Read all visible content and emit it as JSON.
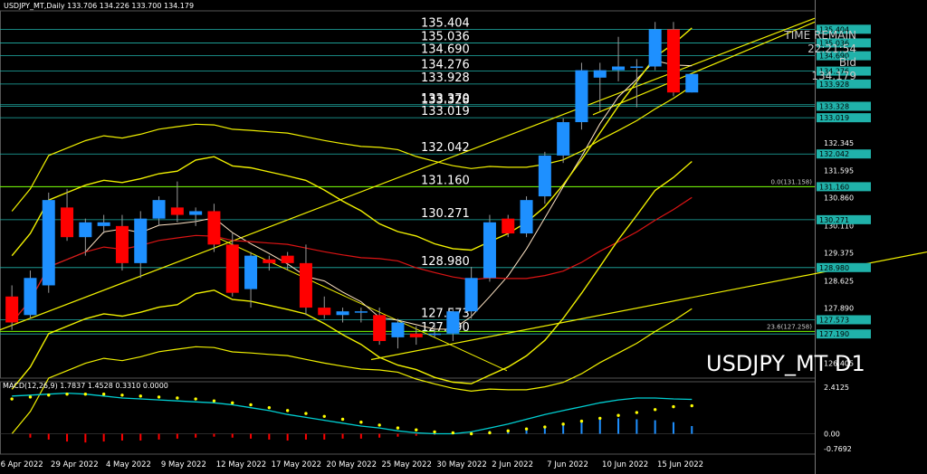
{
  "header": {
    "symbol_line": "USDJPY_MT,Daily 133.706 134.226 133.700 134.179"
  },
  "info_panel": {
    "time_remain_label": "TIME REMAIN",
    "time_remain_value": "22:21:54",
    "bid_label": "Bid",
    "bid_value": "134.179"
  },
  "watermark": "USDJPY_MT D1",
  "macd_label": "MACD(12,26,9) 1.7837 1.4528 0.3310 0.0000",
  "colors": {
    "background": "#000000",
    "bull": "#1e90ff",
    "bear": "#ff0000",
    "level_line": "#20b2aa",
    "envelope": "#f0f000",
    "ma_fast": "#ffe4c4",
    "ma_red": "#dc1414",
    "macd_main": "#00ced1",
    "macd_signal": "#ffff00"
  },
  "chart_data": {
    "type": "candlestick",
    "title": "USDJPY_MT D1",
    "ylim": [
      126.0,
      135.9
    ],
    "y_ticks": [
      "133.908",
      "132.345",
      "131.595",
      "130.860",
      "130.110",
      "129.375",
      "128.625",
      "127.890",
      "127.155",
      "126.405"
    ],
    "x_ticks": [
      {
        "label": "26 Apr 2022",
        "index": 0
      },
      {
        "label": "29 Apr 2022",
        "index": 3
      },
      {
        "label": "4 May 2022",
        "index": 6
      },
      {
        "label": "9 May 2022",
        "index": 9
      },
      {
        "label": "12 May 2022",
        "index": 12
      },
      {
        "label": "17 May 2022",
        "index": 15
      },
      {
        "label": "20 May 2022",
        "index": 18
      },
      {
        "label": "25 May 2022",
        "index": 21
      },
      {
        "label": "30 May 2022",
        "index": 24
      },
      {
        "label": "2 Jun 2022",
        "index": 27
      },
      {
        "label": "7 Jun 2022",
        "index": 30
      },
      {
        "label": "10 Jun 2022",
        "index": 33
      },
      {
        "label": "15 Jun 2022",
        "index": 36
      }
    ],
    "candles": [
      {
        "o": 128.2,
        "h": 128.5,
        "l": 127.3,
        "c": 127.5
      },
      {
        "o": 127.7,
        "h": 128.9,
        "l": 127.6,
        "c": 128.7
      },
      {
        "o": 128.5,
        "h": 131.0,
        "l": 128.3,
        "c": 130.8
      },
      {
        "o": 130.6,
        "h": 131.1,
        "l": 129.7,
        "c": 129.8
      },
      {
        "o": 129.8,
        "h": 130.3,
        "l": 129.3,
        "c": 130.2
      },
      {
        "o": 130.1,
        "h": 130.4,
        "l": 129.9,
        "c": 130.2
      },
      {
        "o": 130.1,
        "h": 130.4,
        "l": 128.9,
        "c": 129.1
      },
      {
        "o": 129.1,
        "h": 130.5,
        "l": 128.7,
        "c": 130.3
      },
      {
        "o": 130.3,
        "h": 130.9,
        "l": 130.1,
        "c": 130.8
      },
      {
        "o": 130.6,
        "h": 131.3,
        "l": 130.2,
        "c": 130.4
      },
      {
        "o": 130.4,
        "h": 130.6,
        "l": 130.1,
        "c": 130.5
      },
      {
        "o": 130.5,
        "h": 130.7,
        "l": 129.4,
        "c": 129.6
      },
      {
        "o": 129.6,
        "h": 129.9,
        "l": 128.2,
        "c": 128.3
      },
      {
        "o": 128.4,
        "h": 129.4,
        "l": 127.9,
        "c": 129.3
      },
      {
        "o": 129.2,
        "h": 129.3,
        "l": 128.9,
        "c": 129.1
      },
      {
        "o": 129.3,
        "h": 129.4,
        "l": 128.9,
        "c": 129.1
      },
      {
        "o": 129.1,
        "h": 129.6,
        "l": 127.7,
        "c": 127.9
      },
      {
        "o": 127.9,
        "h": 128.2,
        "l": 127.6,
        "c": 127.7
      },
      {
        "o": 127.7,
        "h": 127.9,
        "l": 127.5,
        "c": 127.8
      },
      {
        "o": 127.8,
        "h": 127.9,
        "l": 127.5,
        "c": 127.8
      },
      {
        "o": 127.7,
        "h": 127.9,
        "l": 126.9,
        "c": 127.0
      },
      {
        "o": 127.1,
        "h": 127.6,
        "l": 126.8,
        "c": 127.5
      },
      {
        "o": 127.2,
        "h": 127.4,
        "l": 126.9,
        "c": 127.1
      },
      {
        "o": 127.2,
        "h": 127.5,
        "l": 127.1,
        "c": 127.2
      },
      {
        "o": 127.2,
        "h": 127.9,
        "l": 127.0,
        "c": 127.8
      },
      {
        "o": 127.8,
        "h": 129.0,
        "l": 127.6,
        "c": 128.7
      },
      {
        "o": 128.7,
        "h": 130.4,
        "l": 128.6,
        "c": 130.2
      },
      {
        "o": 130.3,
        "h": 130.4,
        "l": 129.8,
        "c": 129.9
      },
      {
        "o": 129.9,
        "h": 130.9,
        "l": 129.8,
        "c": 130.8
      },
      {
        "o": 130.9,
        "h": 132.1,
        "l": 130.7,
        "c": 132.0
      },
      {
        "o": 132.0,
        "h": 133.0,
        "l": 131.8,
        "c": 132.9
      },
      {
        "o": 132.9,
        "h": 134.5,
        "l": 132.7,
        "c": 134.3
      },
      {
        "o": 134.1,
        "h": 134.5,
        "l": 133.2,
        "c": 134.3
      },
      {
        "o": 134.3,
        "h": 135.2,
        "l": 134.0,
        "c": 134.4
      },
      {
        "o": 134.4,
        "h": 134.6,
        "l": 133.3,
        "c": 134.4
      },
      {
        "o": 134.4,
        "h": 135.6,
        "l": 134.3,
        "c": 135.4
      },
      {
        "o": 135.4,
        "h": 135.6,
        "l": 133.6,
        "c": 133.7
      },
      {
        "o": 133.7,
        "h": 134.2,
        "l": 133.7,
        "c": 134.2
      }
    ],
    "levels": [
      {
        "value": 135.404,
        "label": "135.404"
      },
      {
        "value": 135.036,
        "label": "135.036"
      },
      {
        "value": 134.69,
        "label": "134.690"
      },
      {
        "value": 134.276,
        "label": "134.276"
      },
      {
        "value": 133.928,
        "label": "133.928"
      },
      {
        "value": 133.37,
        "label": "133.370"
      },
      {
        "value": 133.328,
        "label": "133.328"
      },
      {
        "value": 133.019,
        "label": "133.019"
      },
      {
        "value": 132.042,
        "label": "132.042"
      },
      {
        "value": 131.16,
        "label": "131.160"
      },
      {
        "value": 130.271,
        "label": "130.271"
      },
      {
        "value": 128.98,
        "label": "128.980"
      },
      {
        "value": 127.573,
        "label": "127.573"
      },
      {
        "value": 127.19,
        "label": "127.190"
      }
    ],
    "right_tags": [
      "135.404",
      "135.036",
      "134.690",
      "134.276",
      "133.928",
      "133.328",
      "133.019",
      "132.042",
      "131.160",
      "130.271",
      "128.980",
      "127.573",
      "127.190"
    ],
    "fib_labels": [
      {
        "value": 131.158,
        "label": "0.0(131.158)"
      },
      {
        "value": 127.258,
        "label": "23.6(127.258)"
      }
    ],
    "macd": {
      "y_ticks": [
        "2.4125",
        "0.00",
        "-0.7692"
      ],
      "ylim": [
        -0.77,
        2.41
      ],
      "histogram": [
        0.0,
        -0.2,
        -0.3,
        -0.4,
        -0.45,
        -0.4,
        -0.35,
        -0.35,
        -0.3,
        -0.25,
        -0.2,
        -0.15,
        -0.2,
        -0.25,
        -0.3,
        -0.35,
        -0.3,
        -0.3,
        -0.25,
        -0.25,
        -0.2,
        -0.15,
        -0.1,
        -0.05,
        0.05,
        0.1,
        0.15,
        0.2,
        0.3,
        0.4,
        0.5,
        0.7,
        0.8,
        0.8,
        0.75,
        0.7,
        0.6,
        0.4
      ],
      "main": [
        1.95,
        2.0,
        2.05,
        2.1,
        2.05,
        1.95,
        1.85,
        1.8,
        1.75,
        1.7,
        1.65,
        1.6,
        1.5,
        1.35,
        1.2,
        1.0,
        0.85,
        0.7,
        0.55,
        0.4,
        0.3,
        0.15,
        0.05,
        0.0,
        0.0,
        0.1,
        0.3,
        0.5,
        0.75,
        1.0,
        1.2,
        1.4,
        1.6,
        1.75,
        1.85,
        1.85,
        1.8,
        1.78
      ],
      "signal": [
        1.8,
        1.9,
        2.0,
        2.05,
        2.05,
        2.05,
        2.0,
        1.95,
        1.9,
        1.85,
        1.8,
        1.7,
        1.6,
        1.5,
        1.35,
        1.2,
        1.05,
        0.9,
        0.75,
        0.6,
        0.45,
        0.3,
        0.2,
        0.1,
        0.05,
        0.0,
        0.05,
        0.15,
        0.25,
        0.35,
        0.5,
        0.65,
        0.8,
        0.95,
        1.1,
        1.25,
        1.4,
        1.45
      ]
    }
  }
}
